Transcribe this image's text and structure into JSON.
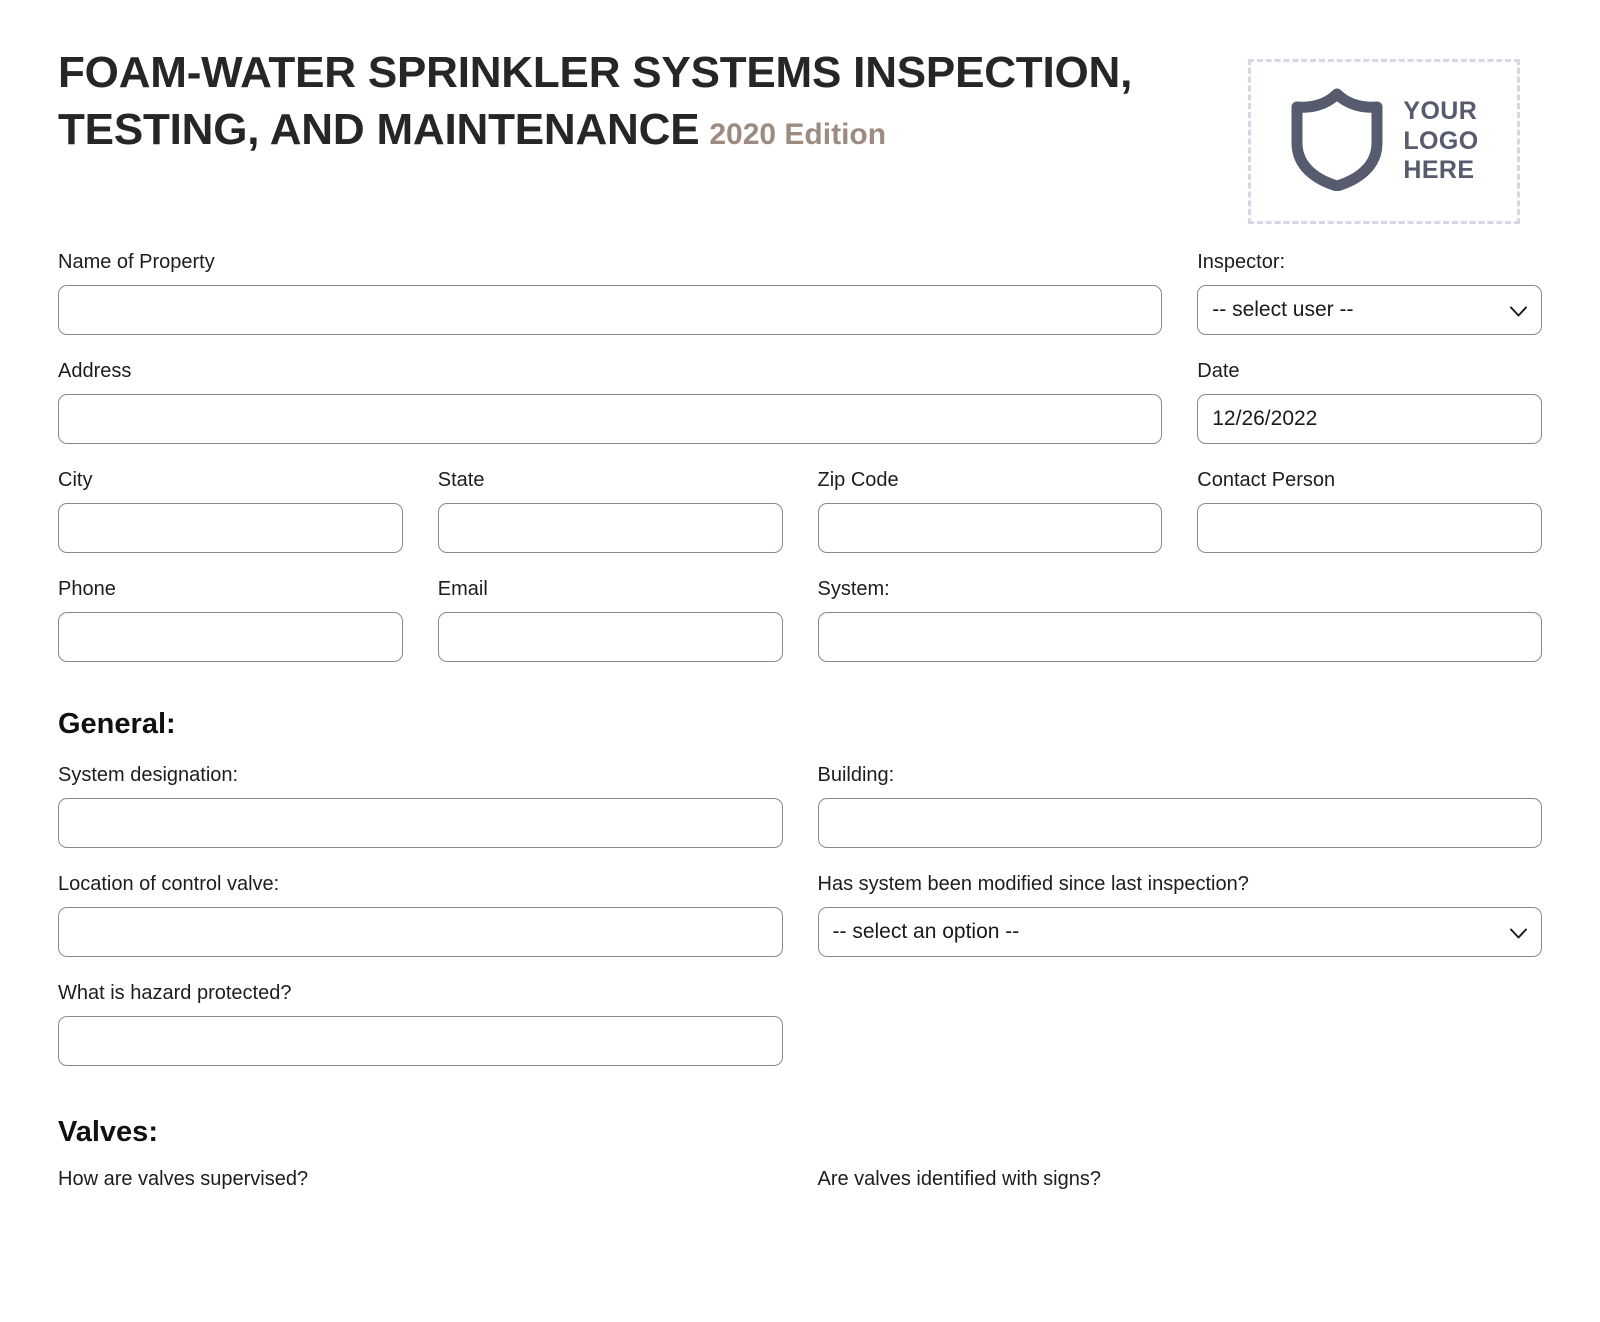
{
  "header": {
    "title": "FOAM-WATER SPRINKLER SYSTEMS INSPECTION, TESTING, AND MAINTENANCE",
    "edition": "2020 Edition",
    "logo": {
      "icon": "shield-icon",
      "line1": "YOUR",
      "line2": "LOGO",
      "line3": "HERE"
    },
    "colors": {
      "title": "#262626",
      "edition": "#9d8b82",
      "logo_ink": "#565b6e",
      "logo_dash": "#d3d8e2"
    }
  },
  "property_section": {
    "name_of_property": {
      "label": "Name of Property",
      "value": ""
    },
    "inspector": {
      "label": "Inspector:",
      "value": "-- select user --",
      "icon": "chevron-down-icon"
    },
    "address": {
      "label": "Address",
      "value": ""
    },
    "date": {
      "label": "Date",
      "value": "12/26/2022"
    },
    "city": {
      "label": "City",
      "value": ""
    },
    "state": {
      "label": "State",
      "value": ""
    },
    "zip_code": {
      "label": "Zip Code",
      "value": ""
    },
    "contact_person": {
      "label": "Contact Person",
      "value": ""
    },
    "phone": {
      "label": "Phone",
      "value": ""
    },
    "email": {
      "label": "Email",
      "value": ""
    },
    "system": {
      "label": "System:",
      "value": ""
    }
  },
  "general_section": {
    "heading": "General:",
    "system_designation": {
      "label": "System designation:",
      "value": ""
    },
    "building": {
      "label": "Building:",
      "value": ""
    },
    "location_of_control_valve": {
      "label": "Location of control valve:",
      "value": ""
    },
    "modified_since_last_inspection": {
      "label": "Has system been modified since last inspection?",
      "value": "-- select an option --",
      "icon": "chevron-down-icon"
    },
    "hazard_protected": {
      "label": "What is hazard protected?",
      "value": ""
    }
  },
  "valves_section": {
    "heading": "Valves:",
    "how_supervised": {
      "label": "How are valves supervised?"
    },
    "identified_with_signs": {
      "label": "Are valves identified with signs?"
    }
  }
}
